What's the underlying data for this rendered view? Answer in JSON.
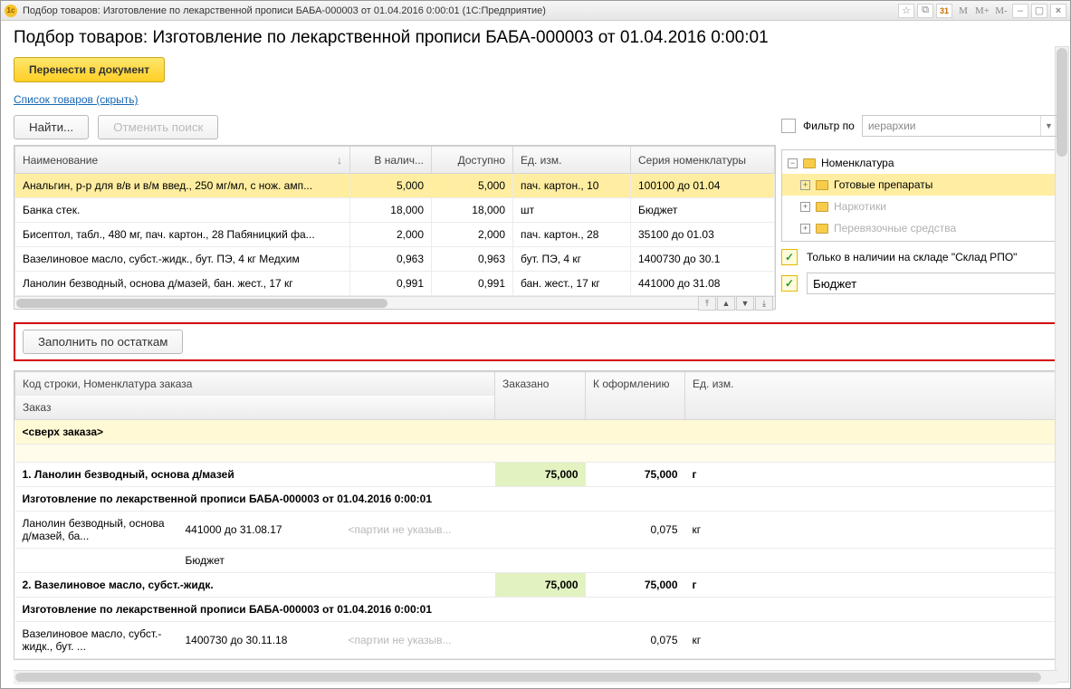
{
  "titlebar": {
    "app_tag": "1c",
    "title": "Подбор товаров: Изготовление по лекарственной прописи БАБА-000003 от 01.04.2016 0:00:01  (1С:Предприятие)",
    "icons": {
      "star": "☆",
      "calc": "⧉",
      "cal": "31",
      "m": "M",
      "mplus": "M+",
      "mminus": "M-",
      "min": "–",
      "max": "▢",
      "close": "×"
    }
  },
  "header": {
    "title": "Подбор товаров: Изготовление по лекарственной прописи БАБА-000003 от 01.04.2016 0:00:01"
  },
  "toolbar": {
    "transfer": "Перенести в документ"
  },
  "link_hide": "Список товаров (скрыть)",
  "buttons": {
    "find": "Найти...",
    "cancel_search": "Отменить поиск",
    "fill_by_stock": "Заполнить по остаткам"
  },
  "nomen_table": {
    "cols": {
      "name": "Наименование",
      "sort_ind": "↓",
      "instock": "В налич...",
      "avail": "Доступно",
      "unit": "Ед. изм.",
      "series": "Серия номенклатуры"
    },
    "rows": [
      {
        "name": "Анальгин, р-р для в/в и в/м введ., 250 мг/мл, с нож. амп...",
        "instock": "5,000",
        "avail": "5,000",
        "unit": "пач. картон., 10",
        "series": "100100 до 01.04",
        "sel": true
      },
      {
        "name": "Банка стек.",
        "instock": "18,000",
        "avail": "18,000",
        "unit": "шт",
        "series": "Бюджет"
      },
      {
        "name": "Бисептол, табл., 480 мг, пач. картон., 28  Пабяницкий фа...",
        "instock": "2,000",
        "avail": "2,000",
        "unit": "пач. картон., 28",
        "series": "35100 до 01.03"
      },
      {
        "name": "Вазелиновое масло, субст.-жидк., бут. ПЭ, 4 кг Медхим",
        "instock": "0,963",
        "avail": "0,963",
        "unit": "бут. ПЭ, 4 кг",
        "series": "1400730 до 30.1"
      },
      {
        "name": "Ланолин безводный, основа д/мазей, бан. жест., 17 кг",
        "instock": "0,991",
        "avail": "0,991",
        "unit": "бан. жест., 17 кг",
        "series": "441000 до 31.08"
      }
    ]
  },
  "filter": {
    "label": "Фильтр по",
    "dropdown_placeholder": "иерархии",
    "tree": [
      {
        "label": "Номенклатура",
        "level": 0,
        "open": true,
        "sel": false
      },
      {
        "label": "Готовые препараты",
        "level": 1,
        "open": false,
        "sel": true
      },
      {
        "label": "Наркотики",
        "level": 1,
        "open": false,
        "sel": false,
        "disabled": true
      },
      {
        "label": "Перевязочные средства",
        "level": 1,
        "open": false,
        "sel": false,
        "disabled": true
      }
    ],
    "only_in_stock": "Только в наличии на складе \"Склад РПО\"",
    "budget_value": "Бюджет"
  },
  "lower": {
    "cols": {
      "c1": "Код строки, Номенклатура заказа",
      "c1b": "Заказ",
      "c2": "Заказано",
      "c3": "К оформлению",
      "c4": "Ед. изм."
    },
    "over_order": "<сверх заказа>",
    "items": [
      {
        "title": "1. Ланолин безводный, основа д/мазей",
        "subtitle": "Изготовление по лекарственной прописи БАБА-000003 от 01.04.2016 0:00:01",
        "ordered": "75,000",
        "to_make": "75,000",
        "unit": "г",
        "detail": {
          "n": "Ланолин безводный, основа д/мазей, ба...",
          "ser": "441000 до 31.08.17",
          "budget": "Бюджет",
          "placeholder": "<партии не указыв...",
          "to_make": "0,075",
          "unit": "кг"
        }
      },
      {
        "title": "2. Вазелиновое масло, субст.-жидк.",
        "subtitle": "Изготовление по лекарственной прописи БАБА-000003 от 01.04.2016 0:00:01",
        "ordered": "75,000",
        "to_make": "75,000",
        "unit": "г",
        "detail": {
          "n": "Вазелиновое масло, субст.-жидк., бут. ...",
          "ser": "1400730 до 30.11.18",
          "budget": "",
          "placeholder": "<партии не указыв...",
          "to_make": "0,075",
          "unit": "кг"
        }
      }
    ]
  }
}
